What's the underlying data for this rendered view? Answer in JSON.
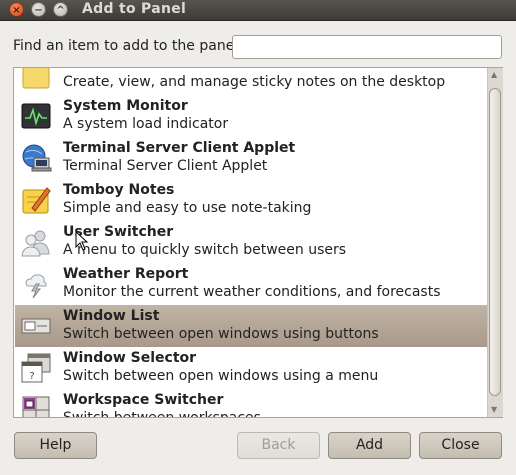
{
  "window": {
    "title": "Add to Panel",
    "controls": {
      "close": "×",
      "minimize": "−",
      "maximize": "^"
    }
  },
  "search": {
    "label": "Find an item to add to the panel:",
    "value": "",
    "placeholder": ""
  },
  "items": [
    {
      "name": "",
      "desc": "Create, view, and manage sticky notes on the desktop",
      "icon": "sticky-notes-icon"
    },
    {
      "name": "System Monitor",
      "desc": "A system load indicator",
      "icon": "system-monitor-icon"
    },
    {
      "name": "Terminal Server Client Applet",
      "desc": "Terminal Server Client Applet",
      "icon": "terminal-server-icon"
    },
    {
      "name": "Tomboy Notes",
      "desc": "Simple and easy to use note-taking",
      "icon": "tomboy-notes-icon"
    },
    {
      "name": "User Switcher",
      "desc": "A menu to quickly switch between users",
      "icon": "user-switcher-icon"
    },
    {
      "name": "Weather Report",
      "desc": "Monitor the current weather conditions, and forecasts",
      "icon": "weather-icon"
    },
    {
      "name": "Window List",
      "desc": "Switch between open windows using buttons",
      "icon": "window-list-icon",
      "selected": true
    },
    {
      "name": "Window Selector",
      "desc": "Switch between open windows using a menu",
      "icon": "window-selector-icon"
    },
    {
      "name": "Workspace Switcher",
      "desc": "Switch between workspaces",
      "icon": "workspace-switcher-icon"
    }
  ],
  "buttons": {
    "help": "Help",
    "back": "Back",
    "add": "Add",
    "close": "Close"
  },
  "colors": {
    "selection": "#b1a494",
    "titlebar": "#3d3b37",
    "close_button": "#e05a2a"
  }
}
